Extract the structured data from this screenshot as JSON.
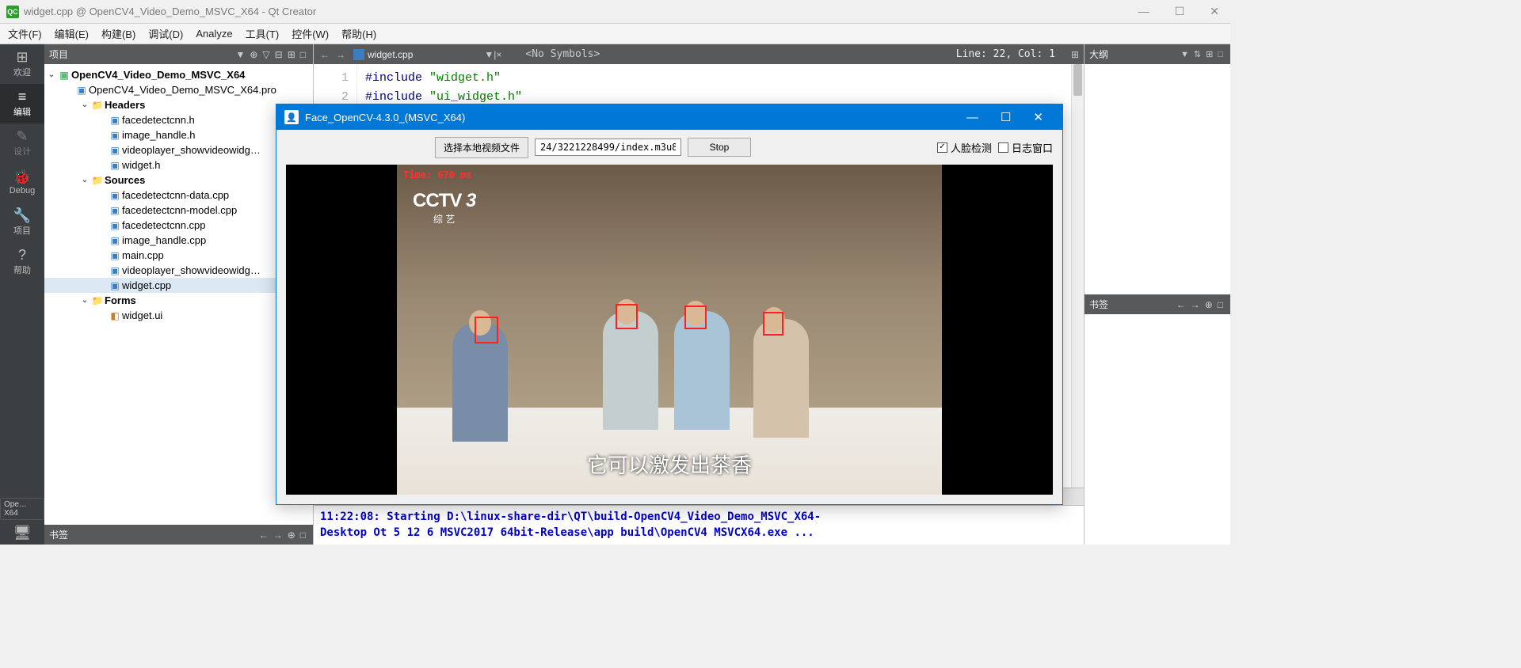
{
  "titlebar": {
    "icon": "QC",
    "text": "widget.cpp @ OpenCV4_Video_Demo_MSVC_X64 - Qt Creator"
  },
  "menu": [
    "文件(F)",
    "编辑(E)",
    "构建(B)",
    "调试(D)",
    "Analyze",
    "工具(T)",
    "控件(W)",
    "帮助(H)"
  ],
  "activity": [
    {
      "icon": "⊞",
      "label": "欢迎"
    },
    {
      "icon": "≡",
      "label": "编辑",
      "active": true
    },
    {
      "icon": "✎",
      "label": "设计"
    },
    {
      "icon": "🐞",
      "label": "Debug"
    },
    {
      "icon": "🔧",
      "label": "项目"
    },
    {
      "icon": "?",
      "label": "帮助"
    }
  ],
  "activity_status": "Ope…X64",
  "project_panel": {
    "title": "项目",
    "toolbar_icons": [
      "▼",
      "⊕",
      "▽",
      "⊟",
      "⊞",
      "□"
    ]
  },
  "tree": {
    "root": "OpenCV4_Video_Demo_MSVC_X64",
    "pro": "OpenCV4_Video_Demo_MSVC_X64.pro",
    "headers": {
      "label": "Headers",
      "files": [
        "facedetectcnn.h",
        "image_handle.h",
        "videoplayer_showvideowidg…",
        "widget.h"
      ]
    },
    "sources": {
      "label": "Sources",
      "files": [
        "facedetectcnn-data.cpp",
        "facedetectcnn-model.cpp",
        "facedetectcnn.cpp",
        "image_handle.cpp",
        "main.cpp",
        "videoplayer_showvideowidg…",
        "widget.cpp"
      ]
    },
    "forms": {
      "label": "Forms",
      "files": [
        "widget.ui"
      ]
    },
    "selected": "widget.cpp"
  },
  "bottom_bookmark": {
    "label": "书签",
    "buttons": [
      "←",
      "→",
      "⊕",
      "□"
    ]
  },
  "editor_header": {
    "file": "widget.cpp",
    "symbols": "<No Symbols>",
    "status": "Line: 22, Col: 1",
    "split_btns": [
      "⊞",
      "#"
    ]
  },
  "outline": {
    "title": "大纲",
    "buttons": [
      "▼",
      "⇅",
      "⊞",
      "□"
    ]
  },
  "outline_bookmark": {
    "label": "书签",
    "buttons": [
      "←",
      "→",
      "⊕",
      "□"
    ]
  },
  "code": {
    "lines": [
      {
        "n": "1",
        "text": [
          "#include ",
          "\"widget.h\""
        ]
      },
      {
        "n": "2",
        "text": [
          "#include ",
          "\"ui_widget.h\""
        ]
      }
    ]
  },
  "output": {
    "lines": [
      "11:22:08: Starting D:\\linux-share-dir\\QT\\build-OpenCV4_Video_Demo_MSVC_X64-",
      "Desktop Ot 5 12 6 MSVC2017 64bit-Release\\app build\\OpenCV4 MSVCX64.exe ..."
    ]
  },
  "facewin": {
    "title": "Face_OpenCV-4.3.0_(MSVC_X64)",
    "btn_select": "选择本地视频文件",
    "input_path": "24/3221228499/index.m3u8",
    "btn_stop": "Stop",
    "chk_face": "人脸检测",
    "chk_log": "日志窗口",
    "video": {
      "time_overlay": "Time: 670 ms",
      "logo_main": "CCTV",
      "logo_num": "3",
      "logo_sub": "综 艺",
      "subtitle": "它可以激发出茶香",
      "face_boxes": 4
    }
  }
}
